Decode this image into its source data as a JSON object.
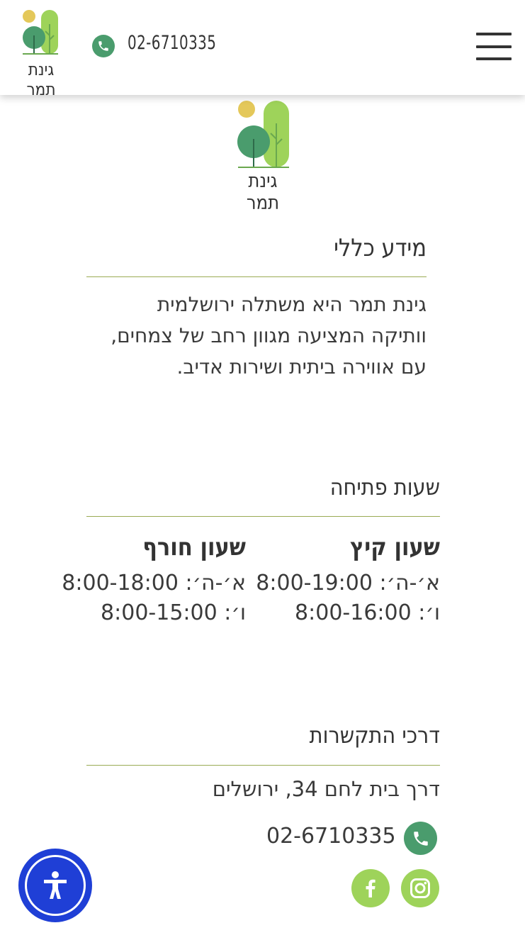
{
  "header": {
    "logo_text": "גינת תמר",
    "phone": "02-6710335",
    "icons": {
      "phone": "phone-icon",
      "menu": "hamburger-menu-icon"
    }
  },
  "main_logo": {
    "text": "גינת תמר"
  },
  "general_info": {
    "title": "מידע כללי",
    "lines": [
      "גינת תמר היא משתלה ירושלמית",
      "וותיקה המציעה מגוון רחב של צמחים,",
      "עם אווירה ביתית ושירות אדיב."
    ]
  },
  "opening_hours": {
    "title": "שעות פתיחה",
    "summer": {
      "title": "שעון קיץ",
      "weekdays": "א׳-ה׳: 8:00-19:00",
      "friday": "ו׳: 8:00-16:00"
    },
    "winter": {
      "title": "שעון חורף",
      "weekdays": "א׳-ה׳: 8:00-18:00",
      "friday": "ו׳: 8:00-15:00"
    }
  },
  "contact": {
    "title": "דרכי התקשרות",
    "address": "דרך בית לחם 34, ירושלים",
    "phone": "02-6710335",
    "icons": {
      "phone": "phone-icon",
      "facebook": "facebook-icon",
      "instagram": "instagram-icon"
    }
  },
  "accessibility": {
    "icon": "accessibility-icon"
  },
  "colors": {
    "brand_green": "#4a9c6d",
    "light_green": "#9ed35a",
    "accent_yellow": "#e4c85a",
    "rule": "#9aab54",
    "accessibility_blue": "#1f3fd6"
  }
}
